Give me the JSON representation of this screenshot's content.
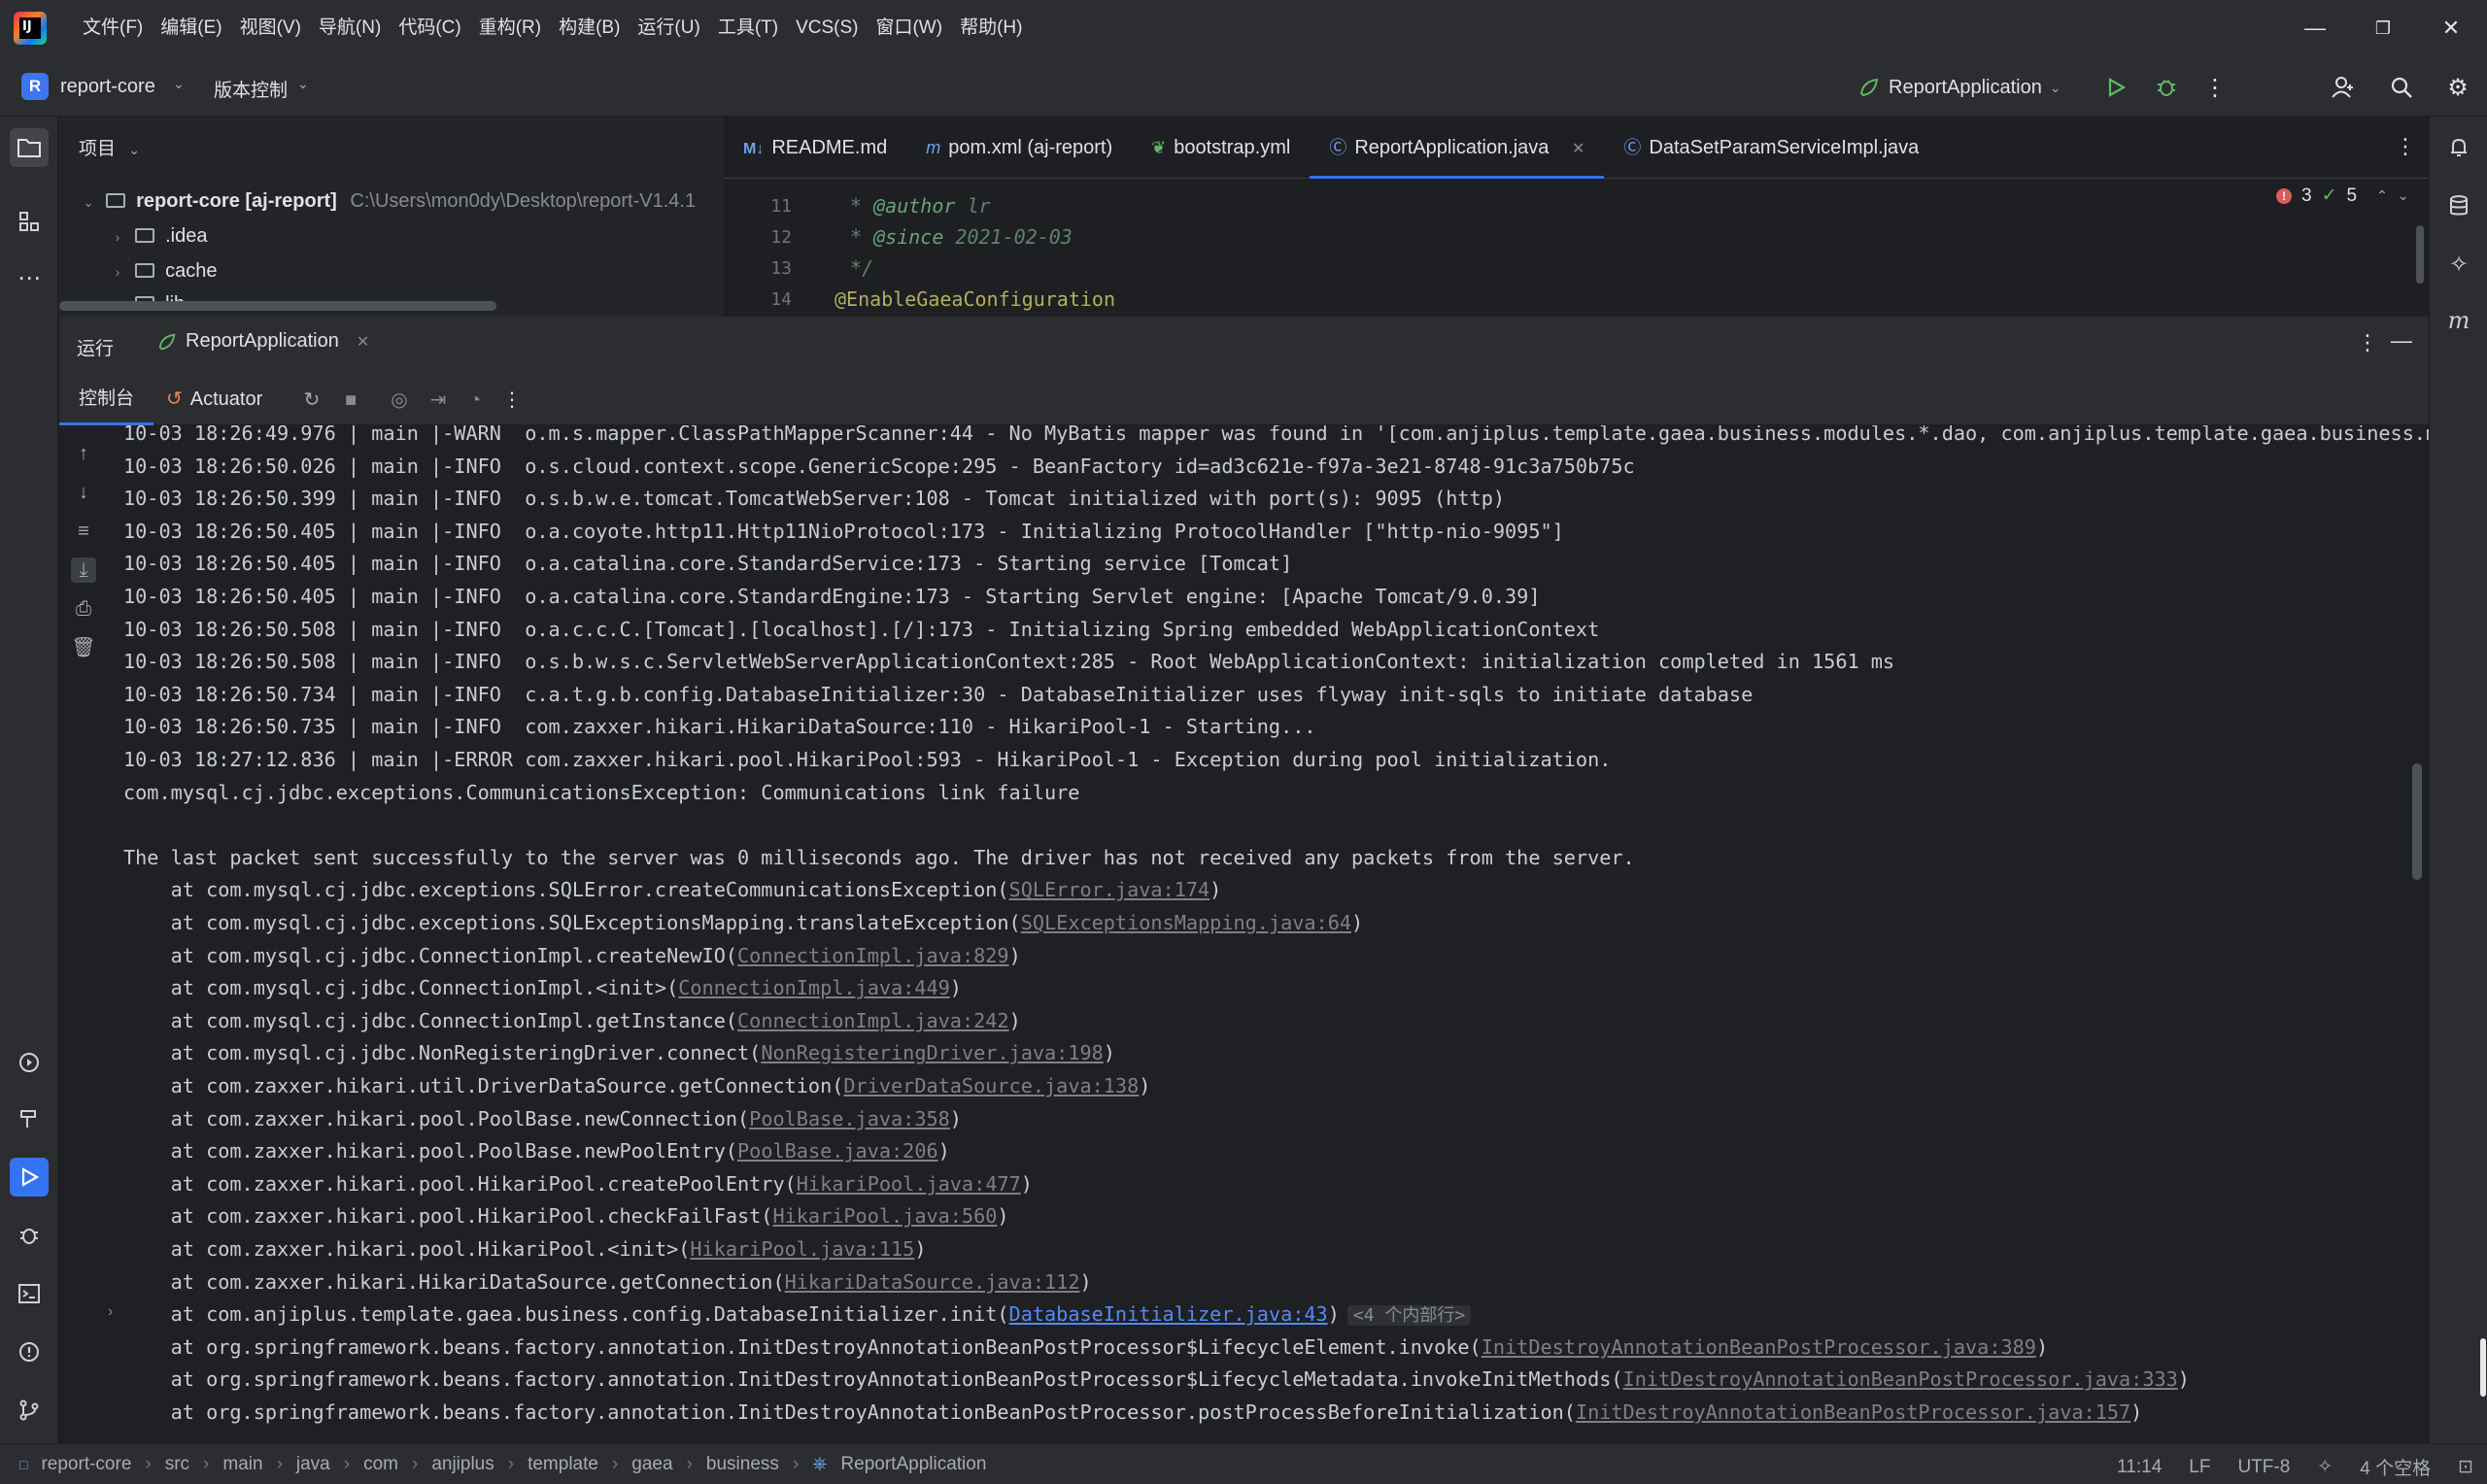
{
  "menu": [
    "文件(F)",
    "编辑(E)",
    "视图(V)",
    "导航(N)",
    "代码(C)",
    "重构(R)",
    "构建(B)",
    "运行(U)",
    "工具(T)",
    "VCS(S)",
    "窗口(W)",
    "帮助(H)"
  ],
  "logo_text": "IJ",
  "window_controls": {
    "minimize": "—",
    "restore": "❐",
    "close": "✕"
  },
  "project_bar": {
    "badge": "R",
    "project_name": "report-core",
    "vcs_label": "版本控制",
    "run_config": "ReportApplication"
  },
  "project_pane": {
    "header": "项目",
    "root_name": "report-core [aj-report]",
    "root_path": "C:\\Users\\mon0dy\\Desktop\\report-V1.4.1",
    "items": [
      ".idea",
      "cache",
      "lib"
    ]
  },
  "editor": {
    "tabs": [
      "README.md",
      "pom.xml (aj-report)",
      "bootstrap.yml",
      "ReportApplication.java",
      "DataSetParamServiceImpl.java"
    ],
    "active_tab": 3,
    "lines": [
      {
        "num": "11",
        "prefix": " * ",
        "tag": "@author",
        "text": " lr"
      },
      {
        "num": "12",
        "prefix": " * ",
        "tag": "@since",
        "text": " 2021-02-03"
      },
      {
        "num": "13",
        "prefix": " */",
        "tag": "",
        "text": ""
      },
      {
        "num": "14",
        "prefix": "",
        "tag": "@EnableGaeaConfiguration",
        "text": ""
      }
    ],
    "inspections": {
      "errors": "3",
      "warnings": "5"
    }
  },
  "run": {
    "title": "运行",
    "tab": "ReportApplication",
    "console_label": "控制台",
    "actuator_label": "Actuator"
  },
  "console_lines": [
    {
      "t": "10-03 18:26:49.976 | main |-WARN  o.m.s.mapper.ClassPathMapperScanner:44 - No MyBatis mapper was found in '[com.anjiplus.template.gaea.business.modules.*.dao, com.anjiplus.template.gaea.business.mod"
    },
    {
      "t": "10-03 18:26:50.026 | main |-INFO  o.s.cloud.context.scope.GenericScope:295 - BeanFactory id=ad3c621e-f97a-3e21-8748-91c3a750b75c"
    },
    {
      "t": "10-03 18:26:50.399 | main |-INFO  o.s.b.w.e.tomcat.TomcatWebServer:108 - Tomcat initialized with port(s): 9095 (http)"
    },
    {
      "t": "10-03 18:26:50.405 | main |-INFO  o.a.coyote.http11.Http11NioProtocol:173 - Initializing ProtocolHandler [\"http-nio-9095\"]"
    },
    {
      "t": "10-03 18:26:50.405 | main |-INFO  o.a.catalina.core.StandardService:173 - Starting service [Tomcat]"
    },
    {
      "t": "10-03 18:26:50.405 | main |-INFO  o.a.catalina.core.StandardEngine:173 - Starting Servlet engine: [Apache Tomcat/9.0.39]"
    },
    {
      "t": "10-03 18:26:50.508 | main |-INFO  o.a.c.c.C.[Tomcat].[localhost].[/]:173 - Initializing Spring embedded WebApplicationContext"
    },
    {
      "t": "10-03 18:26:50.508 | main |-INFO  o.s.b.w.s.c.ServletWebServerApplicationContext:285 - Root WebApplicationContext: initialization completed in 1561 ms"
    },
    {
      "t": "10-03 18:26:50.734 | main |-INFO  c.a.t.g.b.config.DatabaseInitializer:30 - DatabaseInitializer uses flyway init-sqls to initiate database"
    },
    {
      "t": "10-03 18:26:50.735 | main |-INFO  com.zaxxer.hikari.HikariDataSource:110 - HikariPool-1 - Starting..."
    },
    {
      "t": "10-03 18:27:12.836 | main |-ERROR com.zaxxer.hikari.pool.HikariPool:593 - HikariPool-1 - Exception during pool initialization."
    },
    {
      "t": "com.mysql.cj.jdbc.exceptions.CommunicationsException: Communications link failure"
    },
    {
      "t": ""
    },
    {
      "t": "The last packet sent successfully to the server was 0 milliseconds ago. The driver has not received any packets from the server."
    }
  ],
  "stack": [
    {
      "m": "    at com.mysql.cj.jdbc.exceptions.SQLError.createCommunicationsException(",
      "l": "SQLError.java:174",
      "e": ")"
    },
    {
      "m": "    at com.mysql.cj.jdbc.exceptions.SQLExceptionsMapping.translateException(",
      "l": "SQLExceptionsMapping.java:64",
      "e": ")"
    },
    {
      "m": "    at com.mysql.cj.jdbc.ConnectionImpl.createNewIO(",
      "l": "ConnectionImpl.java:829",
      "e": ")"
    },
    {
      "m": "    at com.mysql.cj.jdbc.ConnectionImpl.<init>(",
      "l": "ConnectionImpl.java:449",
      "e": ")"
    },
    {
      "m": "    at com.mysql.cj.jdbc.ConnectionImpl.getInstance(",
      "l": "ConnectionImpl.java:242",
      "e": ")"
    },
    {
      "m": "    at com.mysql.cj.jdbc.NonRegisteringDriver.connect(",
      "l": "NonRegisteringDriver.java:198",
      "e": ")"
    },
    {
      "m": "    at com.zaxxer.hikari.util.DriverDataSource.getConnection(",
      "l": "DriverDataSource.java:138",
      "e": ")"
    },
    {
      "m": "    at com.zaxxer.hikari.pool.PoolBase.newConnection(",
      "l": "PoolBase.java:358",
      "e": ")"
    },
    {
      "m": "    at com.zaxxer.hikari.pool.PoolBase.newPoolEntry(",
      "l": "PoolBase.java:206",
      "e": ")"
    },
    {
      "m": "    at com.zaxxer.hikari.pool.HikariPool.createPoolEntry(",
      "l": "HikariPool.java:477",
      "e": ")"
    },
    {
      "m": "    at com.zaxxer.hikari.pool.HikariPool.checkFailFast(",
      "l": "HikariPool.java:560",
      "e": ")"
    },
    {
      "m": "    at com.zaxxer.hikari.pool.HikariPool.<init>(",
      "l": "HikariPool.java:115",
      "e": ")"
    },
    {
      "m": "    at com.zaxxer.hikari.HikariDataSource.getConnection(",
      "l": "HikariDataSource.java:112",
      "e": ")"
    },
    {
      "m": "    at com.anjiplus.template.gaea.business.config.DatabaseInitializer.init(",
      "l": "DatabaseInitializer.java:43",
      "e": ")",
      "hot": true,
      "fold": "<4 个内部行>"
    },
    {
      "m": "    at org.springframework.beans.factory.annotation.InitDestroyAnnotationBeanPostProcessor$LifecycleElement.invoke(",
      "l": "InitDestroyAnnotationBeanPostProcessor.java:389",
      "e": ")"
    },
    {
      "m": "    at org.springframework.beans.factory.annotation.InitDestroyAnnotationBeanPostProcessor$LifecycleMetadata.invokeInitMethods(",
      "l": "InitDestroyAnnotationBeanPostProcessor.java:333",
      "e": ")"
    },
    {
      "m": "    at org.springframework.beans.factory.annotation.InitDestroyAnnotationBeanPostProcessor.postProcessBeforeInitialization(",
      "l": "InitDestroyAnnotationBeanPostProcessor.java:157",
      "e": ")"
    }
  ],
  "statusbar": {
    "crumbs": [
      "report-core",
      "src",
      "main",
      "java",
      "com",
      "anjiplus",
      "template",
      "gaea",
      "business",
      "ReportApplication"
    ],
    "position": "11:14",
    "line_sep": "LF",
    "encoding": "UTF-8",
    "indent": "4 个空格"
  },
  "colors": {
    "accent": "#3574f0",
    "error": "#db5c5c",
    "success": "#5fb865",
    "link": "#548af7"
  }
}
